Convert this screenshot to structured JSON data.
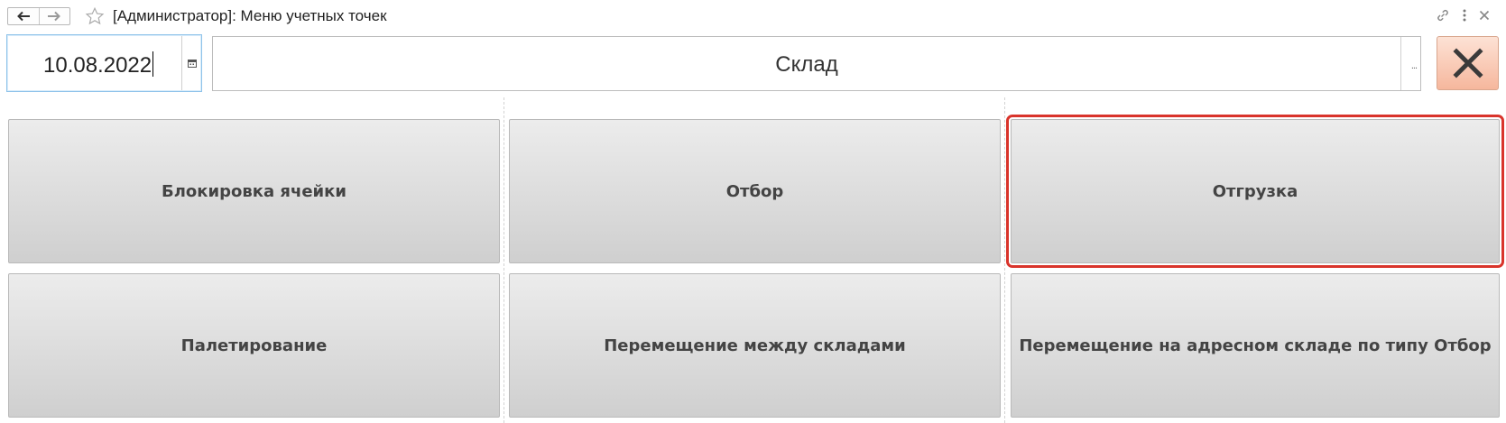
{
  "window": {
    "title": "[Администратор]: Меню учетных точек"
  },
  "toolbar": {
    "date_value": "10.08.2022",
    "warehouse_value": "Склад",
    "warehouse_select_glyph": "...",
    "close_icon": "x-icon"
  },
  "menu": {
    "buttons": [
      {
        "label": "Блокировка ячейки"
      },
      {
        "label": "Отбор"
      },
      {
        "label": "Отгрузка",
        "selected": true
      },
      {
        "label": "Палетирование"
      },
      {
        "label": "Перемещение между складами"
      },
      {
        "label": "Перемещение на адресном складе по типу Отбор"
      }
    ]
  },
  "colors": {
    "selection_outline": "#d9342b",
    "close_button": "#f6b79d",
    "tile_bg": "#dedede"
  }
}
